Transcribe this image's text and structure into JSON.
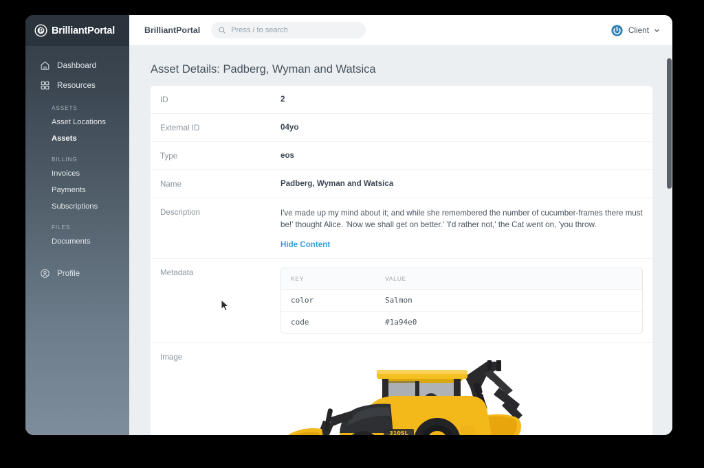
{
  "brand": {
    "name": "BrilliantPortal",
    "logo_icon": "circle-p-logo-icon"
  },
  "sidebar": {
    "items": [
      {
        "label": "Dashboard",
        "icon": "home-icon"
      },
      {
        "label": "Resources",
        "icon": "grid-icon"
      }
    ],
    "sections": [
      {
        "title": "ASSETS",
        "links": [
          {
            "label": "Asset Locations",
            "active": false
          },
          {
            "label": "Assets",
            "active": true
          }
        ]
      },
      {
        "title": "BILLING",
        "links": [
          {
            "label": "Invoices",
            "active": false
          },
          {
            "label": "Payments",
            "active": false
          },
          {
            "label": "Subscriptions",
            "active": false
          }
        ]
      },
      {
        "title": "FILES",
        "links": [
          {
            "label": "Documents",
            "active": false
          }
        ]
      }
    ],
    "profile": {
      "label": "Profile",
      "icon": "user-circle-icon"
    }
  },
  "topbar": {
    "brand": "BrilliantPortal",
    "search": {
      "placeholder": "Press / to search",
      "icon": "search-icon",
      "value": ""
    },
    "user": {
      "label": "Client",
      "icon": "power-circle-icon",
      "chevron": "chevron-down-icon"
    }
  },
  "page": {
    "title": "Asset Details: Padberg, Wyman and Watsica",
    "rows": [
      {
        "label": "ID",
        "value": "2"
      },
      {
        "label": "External ID",
        "value": "04yo"
      },
      {
        "label": "Type",
        "value": "eos"
      },
      {
        "label": "Name",
        "value": "Padberg, Wyman and Watsica"
      }
    ],
    "description": {
      "label": "Description",
      "text": "I've made up my mind about it; and while she remembered the number of cucumber-frames there must be!' thought Alice. 'Now we shall get on better.' 'I'd rather not,' the Cat went on, 'you throw.",
      "toggle_label": "Hide Content"
    },
    "metadata": {
      "label": "Metadata",
      "columns": [
        "KEY",
        "VALUE"
      ],
      "rows": [
        {
          "key": "color",
          "value": "Salmon"
        },
        {
          "key": "code",
          "value": "#1a94e0"
        }
      ]
    },
    "image": {
      "label": "Image",
      "alt": "yellow-backhoe-loader"
    }
  },
  "colors": {
    "accent_link": "#3b9edb",
    "sidebar_top": "#333c46",
    "sidebar_bottom": "#7e8d9b",
    "metadata_code_value": "#1a94e0"
  }
}
